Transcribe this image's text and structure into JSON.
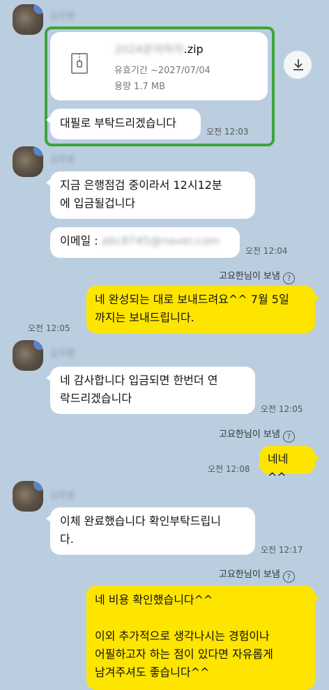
{
  "theme": {
    "background": "#bacee0",
    "my_bubble": "#fee500",
    "other_bubble": "#ffffff",
    "highlight": "#3fa33a"
  },
  "messages": {
    "m1": {
      "sender_name": "김우원",
      "file": {
        "name_blurred": "2024문의하자",
        "ext": ".zip",
        "expiry": "유효기간 ~2027/07/04",
        "size": "용량 1.7 MB"
      },
      "text": "대필로 부탁드리겠습니다",
      "time": "오전 12:03"
    },
    "m2": {
      "sender_name": "김우원",
      "text1_line1": "지금 은행점검 중이라서 12시12분",
      "text1_line2": "에 입금될겁니다",
      "email_label": "이메일 :",
      "email_blurred": "abc8745@naver.com",
      "time": "오전 12:04"
    },
    "m3": {
      "read_by": "고요한님이 보냄",
      "help": "?",
      "line1": "네 완성되는 대로 보내드려요^^ 7월 5일",
      "line2": "까지는 보내드립니다.",
      "time": "오전 12:05"
    },
    "m4": {
      "sender_name": "김우원",
      "line1": "네 감사합니다 입금되면 한번더 연",
      "line2": "락드리겠습니다",
      "time": "오전 12:05"
    },
    "m5": {
      "read_by": "고요한님이 보냄",
      "help": "?",
      "text": "네네^^",
      "time": "오전 12:08"
    },
    "m6": {
      "sender_name": "김우원",
      "line1": "이체 완료했습니다 확인부탁드립니",
      "line2": "다.",
      "time": "오전 12:17"
    },
    "m7": {
      "read_by": "고요한님이 보냄",
      "help": "?",
      "line1": "네 비용 확인했습니다^^",
      "line2": "이외 추가적으로 생각나시는 경험이나",
      "line3": "어필하고자 하는 점이 있다면 자유롭게",
      "line4": "남겨주셔도 좋습니다^^"
    }
  },
  "icons": {
    "file": "file-zip-icon",
    "download": "download-icon",
    "help": "help-circle-icon"
  }
}
